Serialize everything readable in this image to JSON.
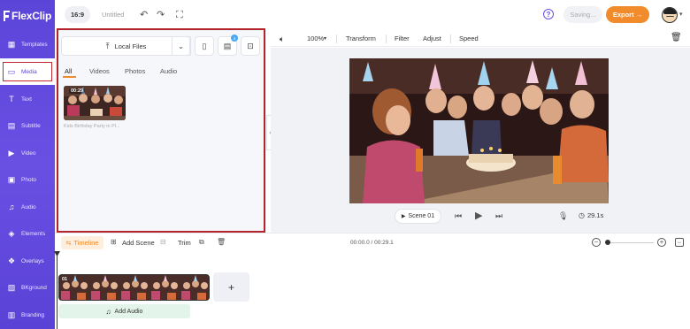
{
  "app": {
    "logo_text": "FlexClip",
    "aspect_ratio": "16:9",
    "project_title": "Untitled",
    "saving_label": "Saving...",
    "export_label": "Export →"
  },
  "sidebar": {
    "items": [
      {
        "label": "Templates",
        "icon": "templates-icon"
      },
      {
        "label": "Media",
        "icon": "media-folder-icon",
        "active": true
      },
      {
        "label": "Text",
        "icon": "text-icon"
      },
      {
        "label": "Subtitle",
        "icon": "subtitle-icon"
      },
      {
        "label": "Video",
        "icon": "video-icon"
      },
      {
        "label": "Photo",
        "icon": "photo-icon"
      },
      {
        "label": "Audio",
        "icon": "audio-icon"
      },
      {
        "label": "Elements",
        "icon": "elements-icon"
      },
      {
        "label": "Overlays",
        "icon": "overlays-icon"
      },
      {
        "label": "BKground",
        "icon": "background-icon"
      },
      {
        "label": "Branding",
        "icon": "branding-icon"
      }
    ]
  },
  "media_panel": {
    "upload_label": "Local Files",
    "badge_count": "4",
    "tabs": [
      "All",
      "Videos",
      "Photos",
      "Audio"
    ],
    "active_tab": "All",
    "items": [
      {
        "duration": "00:29",
        "caption": "Kids Birthday Party in Pl..."
      }
    ]
  },
  "toolbar": {
    "zoom": "100%",
    "transform_label": "Transform",
    "filter_label": "Filter",
    "adjust_label": "Adjust",
    "speed_label": "Speed"
  },
  "player": {
    "scene_label": "Scene 01",
    "duration": "29.1s"
  },
  "timeline": {
    "tab_label": "Timeline",
    "add_scene_label": "Add Scene",
    "trim_label": "Trim",
    "timecode": "00:00.0 / 00:29.1",
    "clip_number": "01",
    "add_audio_label": "Add Audio"
  },
  "colors": {
    "sidebar_bg": "#5b45d8",
    "accent_orange": "#f28b2c",
    "highlight_red": "#b3232a"
  }
}
